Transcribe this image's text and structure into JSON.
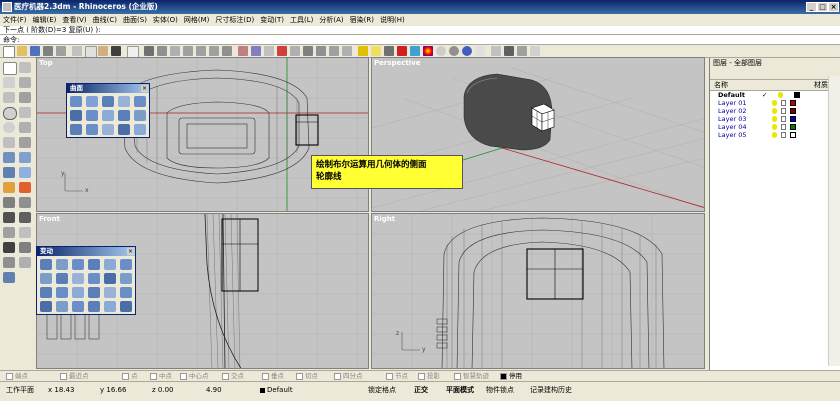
{
  "window": {
    "title": "医疗机器2.3dm - Rhinoceros (企业版)",
    "min": "_",
    "max": "□",
    "close": "×"
  },
  "menu": [
    "文件(F)",
    "编辑(E)",
    "查看(V)",
    "曲线(C)",
    "曲面(S)",
    "实体(O)",
    "网格(M)",
    "尺寸标注(D)",
    "变动(T)",
    "工具(L)",
    "分析(A)",
    "宿染(R)",
    "说明(H)"
  ],
  "command": {
    "history": "下一点 ( 阶数(D)=3  复原(U) ):",
    "prompt": "命令:"
  },
  "viewports": {
    "top": "Top",
    "perspective": "Perspective",
    "front": "Front",
    "right": "Right"
  },
  "axes": {
    "x": "x",
    "y": "y",
    "z": "z"
  },
  "panels": {
    "surface": {
      "title": "曲面",
      "close": "×"
    },
    "transform": {
      "title": "变动",
      "close": "×"
    }
  },
  "annotation": {
    "line1": "绘制布尔运算用几何体的侧面",
    "line2": "轮廓线"
  },
  "layers": {
    "title": "图层 - 全部图层",
    "col_name": "名称",
    "col_material": "材质",
    "rows": [
      {
        "name": "Default",
        "check": "✓",
        "color": "#000000"
      },
      {
        "name": "Layer 01",
        "check": "",
        "color": "#c00000"
      },
      {
        "name": "Layer 02",
        "check": "",
        "color": "#800000"
      },
      {
        "name": "Layer 03",
        "check": "",
        "color": "#0000c0"
      },
      {
        "name": "Layer 04",
        "check": "",
        "color": "#008000"
      },
      {
        "name": "Layer 05",
        "check": "",
        "color": "#ffffff"
      }
    ]
  },
  "osnap": [
    "端点",
    "最近点",
    "点",
    "中点",
    "中心点",
    "交点",
    "垂点",
    "切点",
    "四分点",
    "节点",
    "投影",
    "智慧轨迹",
    "停用"
  ],
  "osnap_checked": [
    "停用"
  ],
  "status": {
    "cplane": "工作平面",
    "x": "x 18.43",
    "y": "y 16.66",
    "z": "z 0.00",
    "val": "4.90",
    "layer": "Default",
    "grid": "锁定格点",
    "ortho": "正交",
    "planar": "平面模式",
    "objsnap": "物件锁点",
    "history": "记录建构历史"
  }
}
